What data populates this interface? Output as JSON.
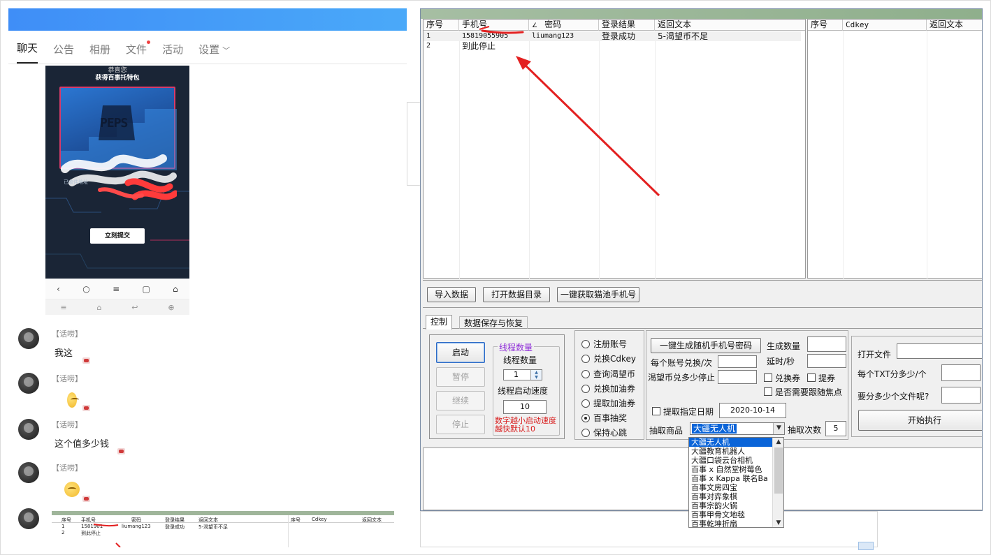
{
  "chat": {
    "tabs": [
      {
        "label": "聊天"
      },
      {
        "label": "公告"
      },
      {
        "label": "相册"
      },
      {
        "label": "文件"
      },
      {
        "label": "活动"
      },
      {
        "label": "设置"
      }
    ],
    "phone": {
      "congrats": "恭喜您",
      "prize_line": "获得百事托特包",
      "brand": "PEPS",
      "addr_label": "已收件地址",
      "submit_label": "立刻提交"
    },
    "messages": [
      {
        "tag": "【话唠】",
        "text": "我这"
      },
      {
        "tag": "【话唠】",
        "text": ""
      },
      {
        "tag": "【话唠】",
        "text": "这个值多少钱"
      },
      {
        "tag": "【话唠】",
        "text": ""
      }
    ],
    "thumb": {
      "headers": [
        "序号",
        "手机号",
        "密码",
        "登录结果",
        "返回文本",
        "序号",
        "Cdkey",
        "返回文本"
      ],
      "row1": [
        "1",
        "1581901",
        "liumang123",
        "登录成功",
        "5-渴望币不足"
      ],
      "row2": [
        "2",
        "到此停止"
      ]
    }
  },
  "app": {
    "left_grid": {
      "headers": [
        "序号",
        "手机号",
        "密码",
        "登录结果",
        "返回文本"
      ],
      "rows": [
        {
          "idx": "1",
          "phone": "15819055905",
          "pwd": "liumang123",
          "result": "登录成功",
          "text": "5-渴望币不足"
        },
        {
          "idx": "2",
          "phone": "到此停止",
          "pwd": "",
          "result": "",
          "text": ""
        }
      ]
    },
    "right_grid": {
      "headers": [
        "序号",
        "Cdkey",
        "返回文本"
      ]
    },
    "buttons": {
      "import": "导入数据",
      "open_dir": "打开数据目录",
      "get_phones": "一键获取猫池手机号"
    },
    "tabs": [
      "控制",
      "数据保存与恢复"
    ],
    "control": {
      "start": "启动",
      "pause": "暂停",
      "resume": "继续",
      "stop": "停止",
      "group_title": "线程数量",
      "thread_label": "线程数量",
      "thread_value": "1",
      "speed_label": "线程启动速度",
      "speed_value": "10",
      "hint": "数字越小启动速度越快默认10"
    },
    "modes": [
      {
        "label": "注册账号",
        "selected": false
      },
      {
        "label": "兑换Cdkey",
        "selected": false
      },
      {
        "label": "查询渴望币",
        "selected": false
      },
      {
        "label": "兑换加油券",
        "selected": false
      },
      {
        "label": "提取加油券",
        "selected": false
      },
      {
        "label": "百事抽奖",
        "selected": true
      },
      {
        "label": "保持心跳",
        "selected": false
      }
    ],
    "options": {
      "gen_button": "一键生成随机手机号密码",
      "gen_count_label": "生成数量",
      "gen_count_value": "",
      "per_account_label": "每个账号兑换/次",
      "per_account_value": "",
      "delay_label": "延时/秒",
      "delay_value": "",
      "stop_label": "渴望币兑多少停止",
      "stop_value": "",
      "chk_exchange": "兑换券",
      "chk_coupon": "提券",
      "chk_focus": "是否需要跟随焦点",
      "chk_date": "提取指定日期",
      "date_value": "2020-10-14",
      "prize_label": "抽取商品",
      "prize_selected": "大疆无人机",
      "draws_label": "抽取次数",
      "draws_value": "5"
    },
    "files": {
      "open_label": "打开文件",
      "per_txt_label": "每个TXT分多少/个",
      "how_many_label": "要分多少个文件呢?",
      "start_button": "开始执行"
    },
    "dropdown_options": [
      "大疆无人机",
      "大疆教育机器人",
      "大疆口袋云台相机",
      "百事 x 自然堂树莓色",
      "百事 x Kappa 联名Ba",
      "百事文房四宝",
      "百事对弈象棋",
      "百事宗韵火锅",
      "百事甲骨文地毯",
      "百事乾坤折扇"
    ]
  },
  "colors": {
    "annotation": "#e32020",
    "selection": "#0a64d8",
    "hint": "#d81b1b",
    "group_title": "#8e2bd8"
  }
}
